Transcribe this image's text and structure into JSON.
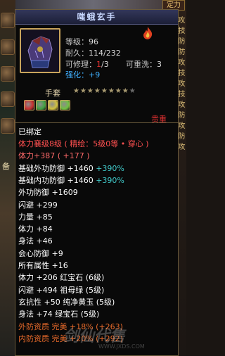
{
  "background": {
    "top_right_label": "定力",
    "right_tabs": [
      "攻",
      "技",
      "防",
      "防",
      "攻",
      "技",
      "攻",
      "技",
      "攻",
      "防",
      "攻",
      "防",
      "攻"
    ],
    "left_chars": [
      "备"
    ]
  },
  "tooltip": {
    "title": "嗤蛾玄手",
    "level_label": "等级：",
    "level_value": "96",
    "durability_label": "耐久：",
    "durability_value": "114/232",
    "repairable_label": "可修理：",
    "repairable_current": "1",
    "repairable_total": "/3",
    "rewash_label": "可重洗：",
    "rewash_value": "3",
    "enhance_label": "强化：",
    "enhance_value": "+9",
    "item_type": "手套",
    "stars_filled": "★★★★★★★★",
    "stars_empty": "★",
    "rarity": "贵重",
    "bound": "已绑定",
    "attributes": [
      {
        "text": "体力襄级8级 ( 精绘：5级0等 • 穿心 )",
        "color": "#ff5050"
      },
      {
        "text": "体力+387 ( +177 )",
        "color": "#ff6a6a"
      },
      {
        "text": "基础外功防御 +1460 ",
        "extra": "+390%",
        "color": "#ffffff",
        "extra_color": "#40c8c8"
      },
      {
        "text": "基础内功防御 +1460 ",
        "extra": "+390%",
        "color": "#ffffff",
        "extra_color": "#40c8c8"
      },
      {
        "text": "外功防御 +1609",
        "color": "#ffffff"
      },
      {
        "text": "闪避 +299",
        "color": "#ffffff"
      },
      {
        "text": "力量 +85",
        "color": "#ffffff"
      },
      {
        "text": "体力 +84",
        "color": "#ffffff"
      },
      {
        "text": "身法 +46",
        "color": "#ffffff"
      },
      {
        "text": "会心防御 +9",
        "color": "#ffffff"
      },
      {
        "text": "所有属性 +16",
        "color": "#ffffff"
      },
      {
        "text": "体力 +206  红宝石 (6级)",
        "color": "#ffffff"
      },
      {
        "text": "闪避 +494  祖母绿 (5级)",
        "color": "#ffffff"
      },
      {
        "text": "玄抗性 +50  纯净黄玉 (5级)",
        "color": "#ffffff"
      },
      {
        "text": "身法 +74  绿宝石 (5级)",
        "color": "#ffffff"
      },
      {
        "text": "外防资质   完美 +18% (+263)",
        "color": "#e86a2a"
      },
      {
        "text": "内防资质   完美 +20% (+292)",
        "color": "#e86a2a"
      }
    ],
    "gems": [
      {
        "name": "red-gem",
        "color": "#c83030"
      },
      {
        "name": "green-gem",
        "color": "#40a040"
      },
      {
        "name": "yellow-gem",
        "color": "#d0c040"
      },
      {
        "name": "lime-gem",
        "color": "#70c040"
      }
    ]
  },
  "watermark": {
    "main": "剑仙代售",
    "sub": "WWW.JXDS.COM"
  }
}
